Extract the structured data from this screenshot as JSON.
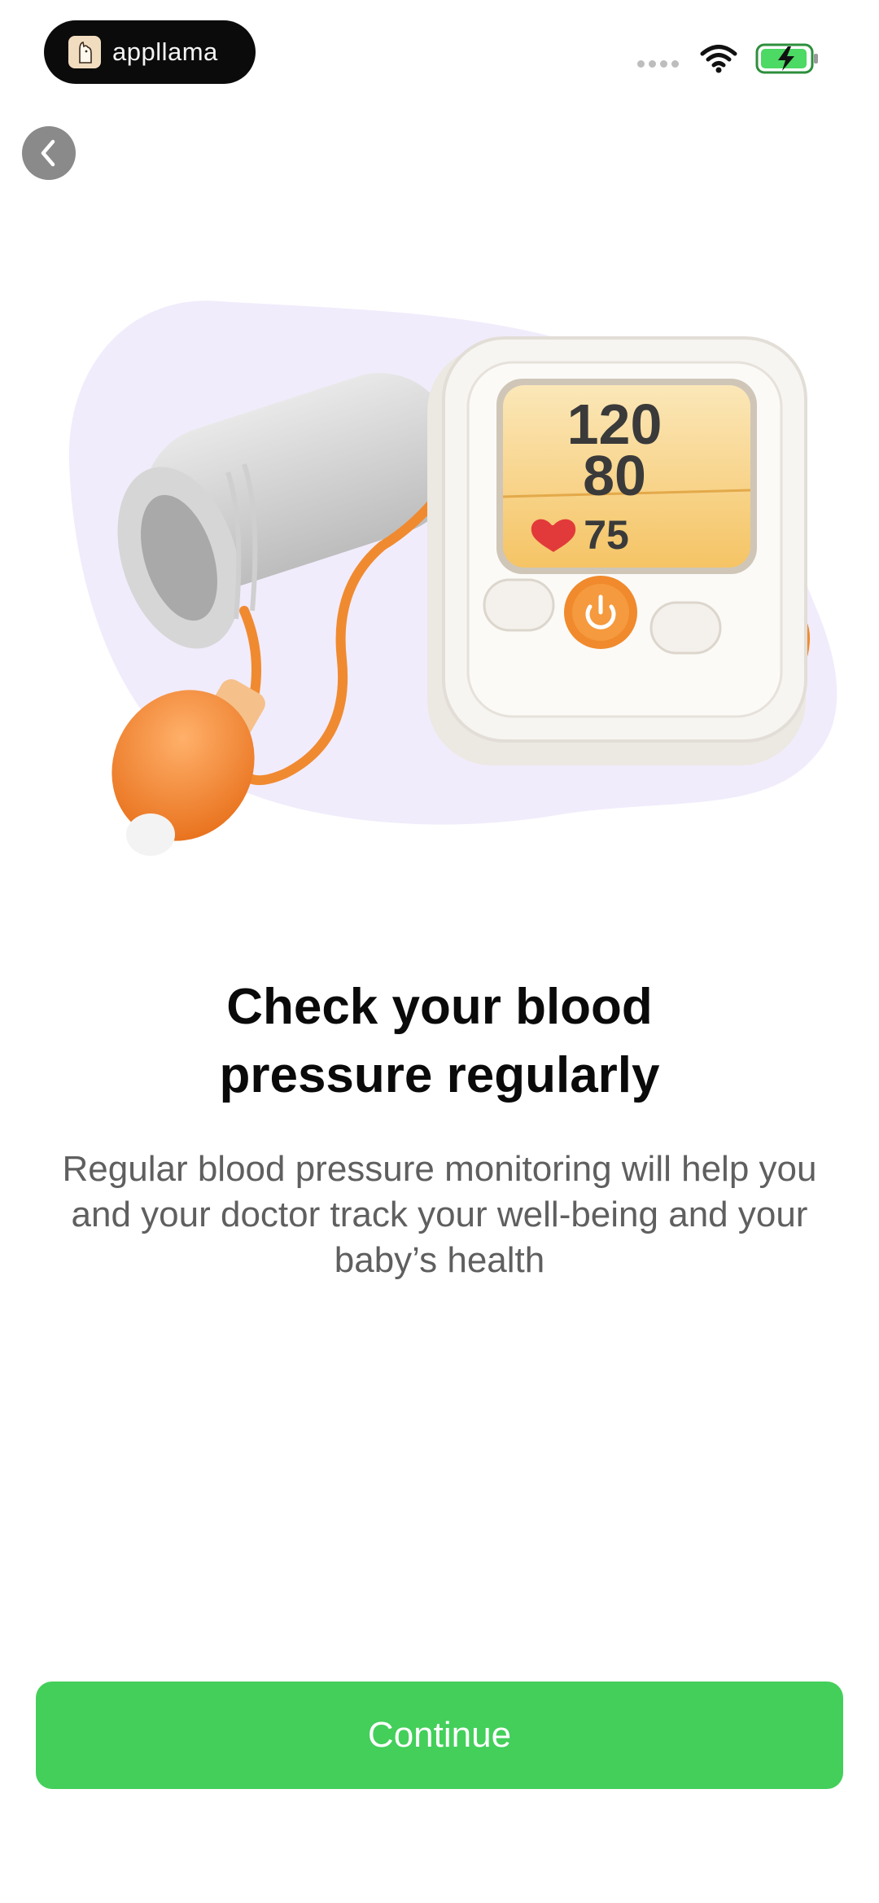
{
  "status_bar": {
    "app_name": "appllama"
  },
  "hero": {
    "monitor_systolic": "120",
    "monitor_diastolic": "80",
    "monitor_pulse": "75"
  },
  "content": {
    "title_line1": "Check your blood",
    "title_line2": "pressure regularly",
    "description": "Regular blood pressure monitoring will help you and your doctor track your well-being and your baby’s health"
  },
  "actions": {
    "continue_label": "Continue"
  },
  "colors": {
    "accent_green": "#43cf5a",
    "blob_lavender": "#f1ecfb",
    "device_orange": "#f28a2c"
  },
  "icons": {
    "back": "chevron-left-icon",
    "wifi": "wifi-icon",
    "battery": "battery-charging-icon",
    "signal": "cellular-signal-icon"
  }
}
